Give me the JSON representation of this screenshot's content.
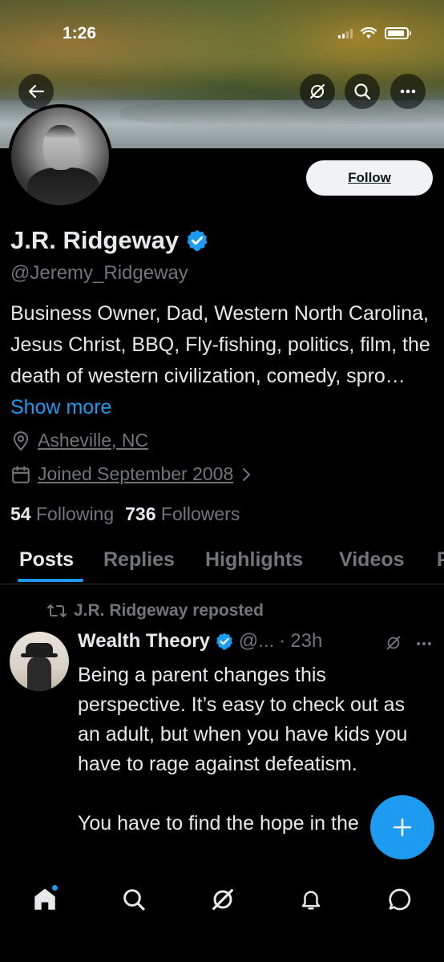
{
  "status_bar": {
    "time": "1:26"
  },
  "profile": {
    "follow_label": "Follow",
    "display_name": "J.R. Ridgeway",
    "handle": "@Jeremy_Ridgeway",
    "bio": "Business Owner, Dad, Western North Carolina, Jesus Christ, BBQ, Fly-fishing, politics, film, the death of western civilization, comedy, spro…",
    "show_more": "Show more",
    "location": "Asheville, NC",
    "joined": "Joined September 2008",
    "following_count": "54",
    "following_label": "Following",
    "followers_count": "736",
    "followers_label": "Followers"
  },
  "tabs": [
    "Posts",
    "Replies",
    "Highlights",
    "Videos",
    "P"
  ],
  "post": {
    "repost_label": "J.R. Ridgeway reposted",
    "author": "Wealth Theory",
    "handle_truncated": "@...",
    "separator": "·",
    "time": "23h",
    "paragraph1": "Being a parent changes this perspective. It’s easy to check out as an adult, but when you have kids you have to rage against defeatism.",
    "paragraph2": "You have to find the hope in the"
  },
  "colors": {
    "accent": "#1d9bf0",
    "background": "#000000",
    "muted": "#71767b",
    "text": "#e7e9ea"
  },
  "icons": {
    "back": "arrow-left-icon",
    "grok": "grok-icon",
    "search": "search-icon",
    "more": "more-icon",
    "verified": "verified-badge-icon",
    "location": "location-pin-icon",
    "calendar": "calendar-icon",
    "repost": "repost-icon",
    "compose": "plus-icon",
    "home": "home-icon",
    "bell": "bell-icon",
    "message": "message-icon"
  }
}
